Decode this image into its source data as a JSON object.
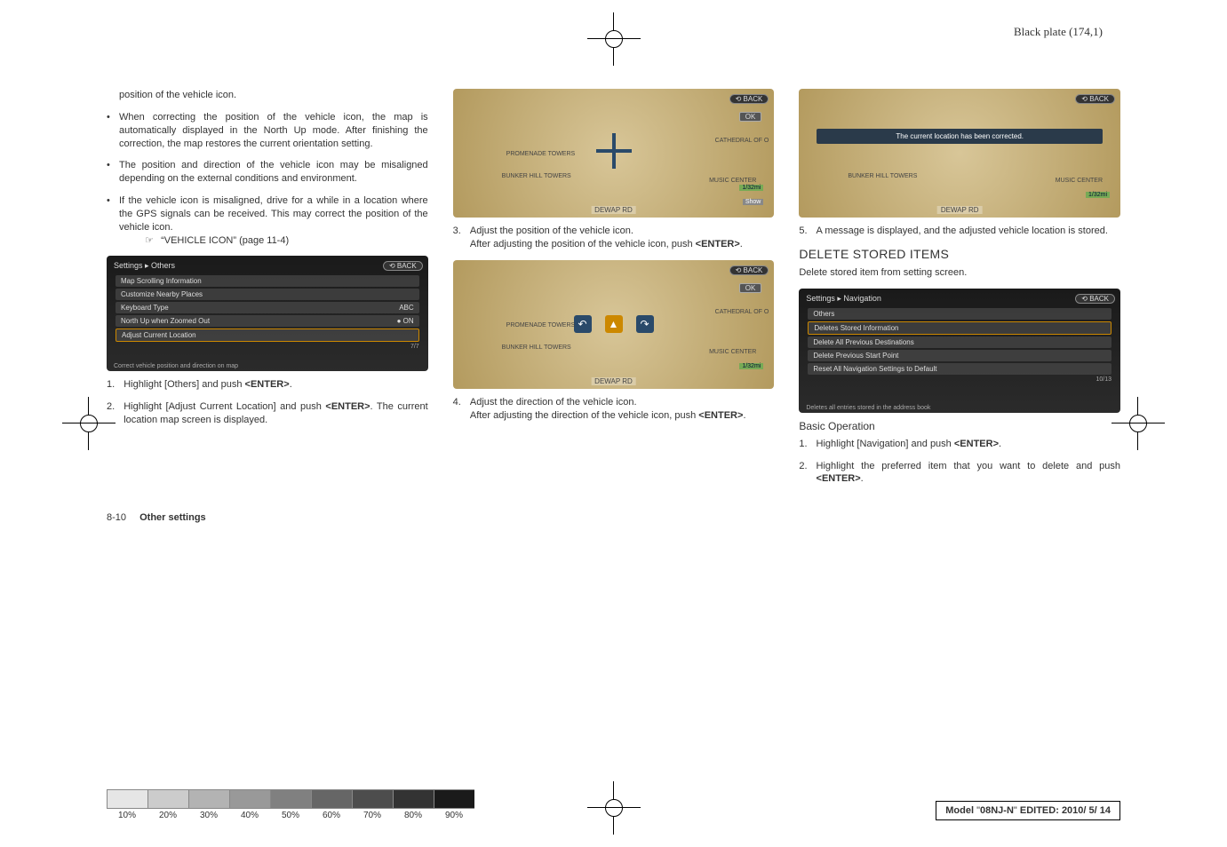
{
  "plate_header": "Black plate (174,1)",
  "col1": {
    "intro": "position of the vehicle icon.",
    "bullets": [
      "When correcting the position of the vehicle icon, the map is automatically displayed in the North Up mode. After finishing the correction, the map restores the current orientation setting.",
      "The position and direction of the vehicle icon may be misaligned depending on the external conditions and environment.",
      "If the vehicle icon is misaligned, drive for a while in a location where the GPS signals can be received. This may correct the position of the vehicle icon."
    ],
    "ref_icon": "☞",
    "ref_text": "“VEHICLE ICON” (page 11-4)",
    "menu": {
      "title": "Settings ▸ Others",
      "back": "⟲ BACK",
      "items": [
        {
          "label": "Map Scrolling Information",
          "right": ""
        },
        {
          "label": "Customize Nearby Places",
          "right": ""
        },
        {
          "label": "Keyboard Type",
          "right": "ABC"
        },
        {
          "label": "North Up when Zoomed Out",
          "right": "● ON"
        },
        {
          "label": "Adjust Current Location",
          "right": "",
          "sel": true
        }
      ],
      "page": "7/7",
      "footer": "Correct vehicle position and direction on map"
    },
    "steps": [
      {
        "n": "1.",
        "t_pre": "Highlight [Others] and push ",
        "enter": "<ENTER>",
        "t_post": "."
      },
      {
        "n": "2.",
        "t_pre": "Highlight [Adjust Current Location] and push ",
        "enter": "<ENTER>",
        "t_post": ". The current location map screen is displayed."
      }
    ]
  },
  "col2": {
    "map1": {
      "back": "⟲ BACK",
      "ok": "OK",
      "labels": {
        "r1": "PROMENADE TOWERS",
        "r2": "BUNKER HILL TOWERS",
        "r3": "MUSIC CENTER",
        "r4": "CATHEDRAL OF O",
        "bottom": "DEWAP RD",
        "dist": "1/32mi",
        "show": "Show"
      }
    },
    "step3": {
      "n": "3.",
      "t1": "Adjust the position of the vehicle icon.",
      "t2_pre": "After adjusting the position of the vehicle icon, push ",
      "enter": "<ENTER>",
      "t2_post": "."
    },
    "map2": {
      "back": "⟲ BACK",
      "ok": "OK",
      "labels": {
        "r1": "PROMENADE TOWERS",
        "r2": "BUNKER HILL TOWERS",
        "r3": "MUSIC CENTER",
        "r4": "CATHEDRAL OF O",
        "bottom": "DEWAP RD",
        "dist": "1/32mi"
      }
    },
    "step4": {
      "n": "4.",
      "t1": "Adjust the direction of the vehicle icon.",
      "t2_pre": "After adjusting the direction of the vehicle icon, push ",
      "enter": "<ENTER>",
      "t2_post": "."
    }
  },
  "col3": {
    "map3": {
      "back": "⟲ BACK",
      "msg": "The current location has been corrected.",
      "labels": {
        "r2": "BUNKER HILL TOWERS",
        "r3": "MUSIC CENTER",
        "bottom": "DEWAP RD",
        "dist": "1/32mi"
      }
    },
    "step5": {
      "n": "5.",
      "t": "A message is displayed, and the adjusted vehicle location is stored."
    },
    "h3": "DELETE STORED ITEMS",
    "sub": "Delete stored item from setting screen.",
    "menu": {
      "title": "Settings ▸ Navigation",
      "back": "⟲ BACK",
      "items": [
        {
          "label": "Others",
          "right": ""
        },
        {
          "label": "Deletes Stored Information",
          "right": "",
          "sel": true
        },
        {
          "label": "Delete All Previous Destinations",
          "right": ""
        },
        {
          "label": "Delete Previous Start Point",
          "right": ""
        },
        {
          "label": "Reset All Navigation Settings to Default",
          "right": ""
        }
      ],
      "page": "10/13",
      "footer": "Deletes all entries stored in the address book"
    },
    "h4": "Basic Operation",
    "steps": [
      {
        "n": "1.",
        "t_pre": "Highlight [Navigation] and push ",
        "enter": "<ENTER>",
        "t_post": "."
      },
      {
        "n": "2.",
        "t_pre": "Highlight the preferred item that you want to delete and push ",
        "enter": "<ENTER>",
        "t_post": "."
      }
    ]
  },
  "footer": {
    "num": "8-10",
    "label": "Other settings"
  },
  "grayscale": [
    "10%",
    "20%",
    "30%",
    "40%",
    "50%",
    "60%",
    "70%",
    "80%",
    "90%"
  ],
  "grayscale_colors": [
    "#e6e6e6",
    "#cccccc",
    "#b3b3b3",
    "#999999",
    "#808080",
    "#666666",
    "#4d4d4d",
    "#333333",
    "#1a1a1a"
  ],
  "model": {
    "pre": "Model ",
    "q1": "\"",
    "name": "08NJ-N",
    "q2": "\"",
    "mid": "  EDITED:  ",
    "date": "2010/ 5/ 14"
  }
}
